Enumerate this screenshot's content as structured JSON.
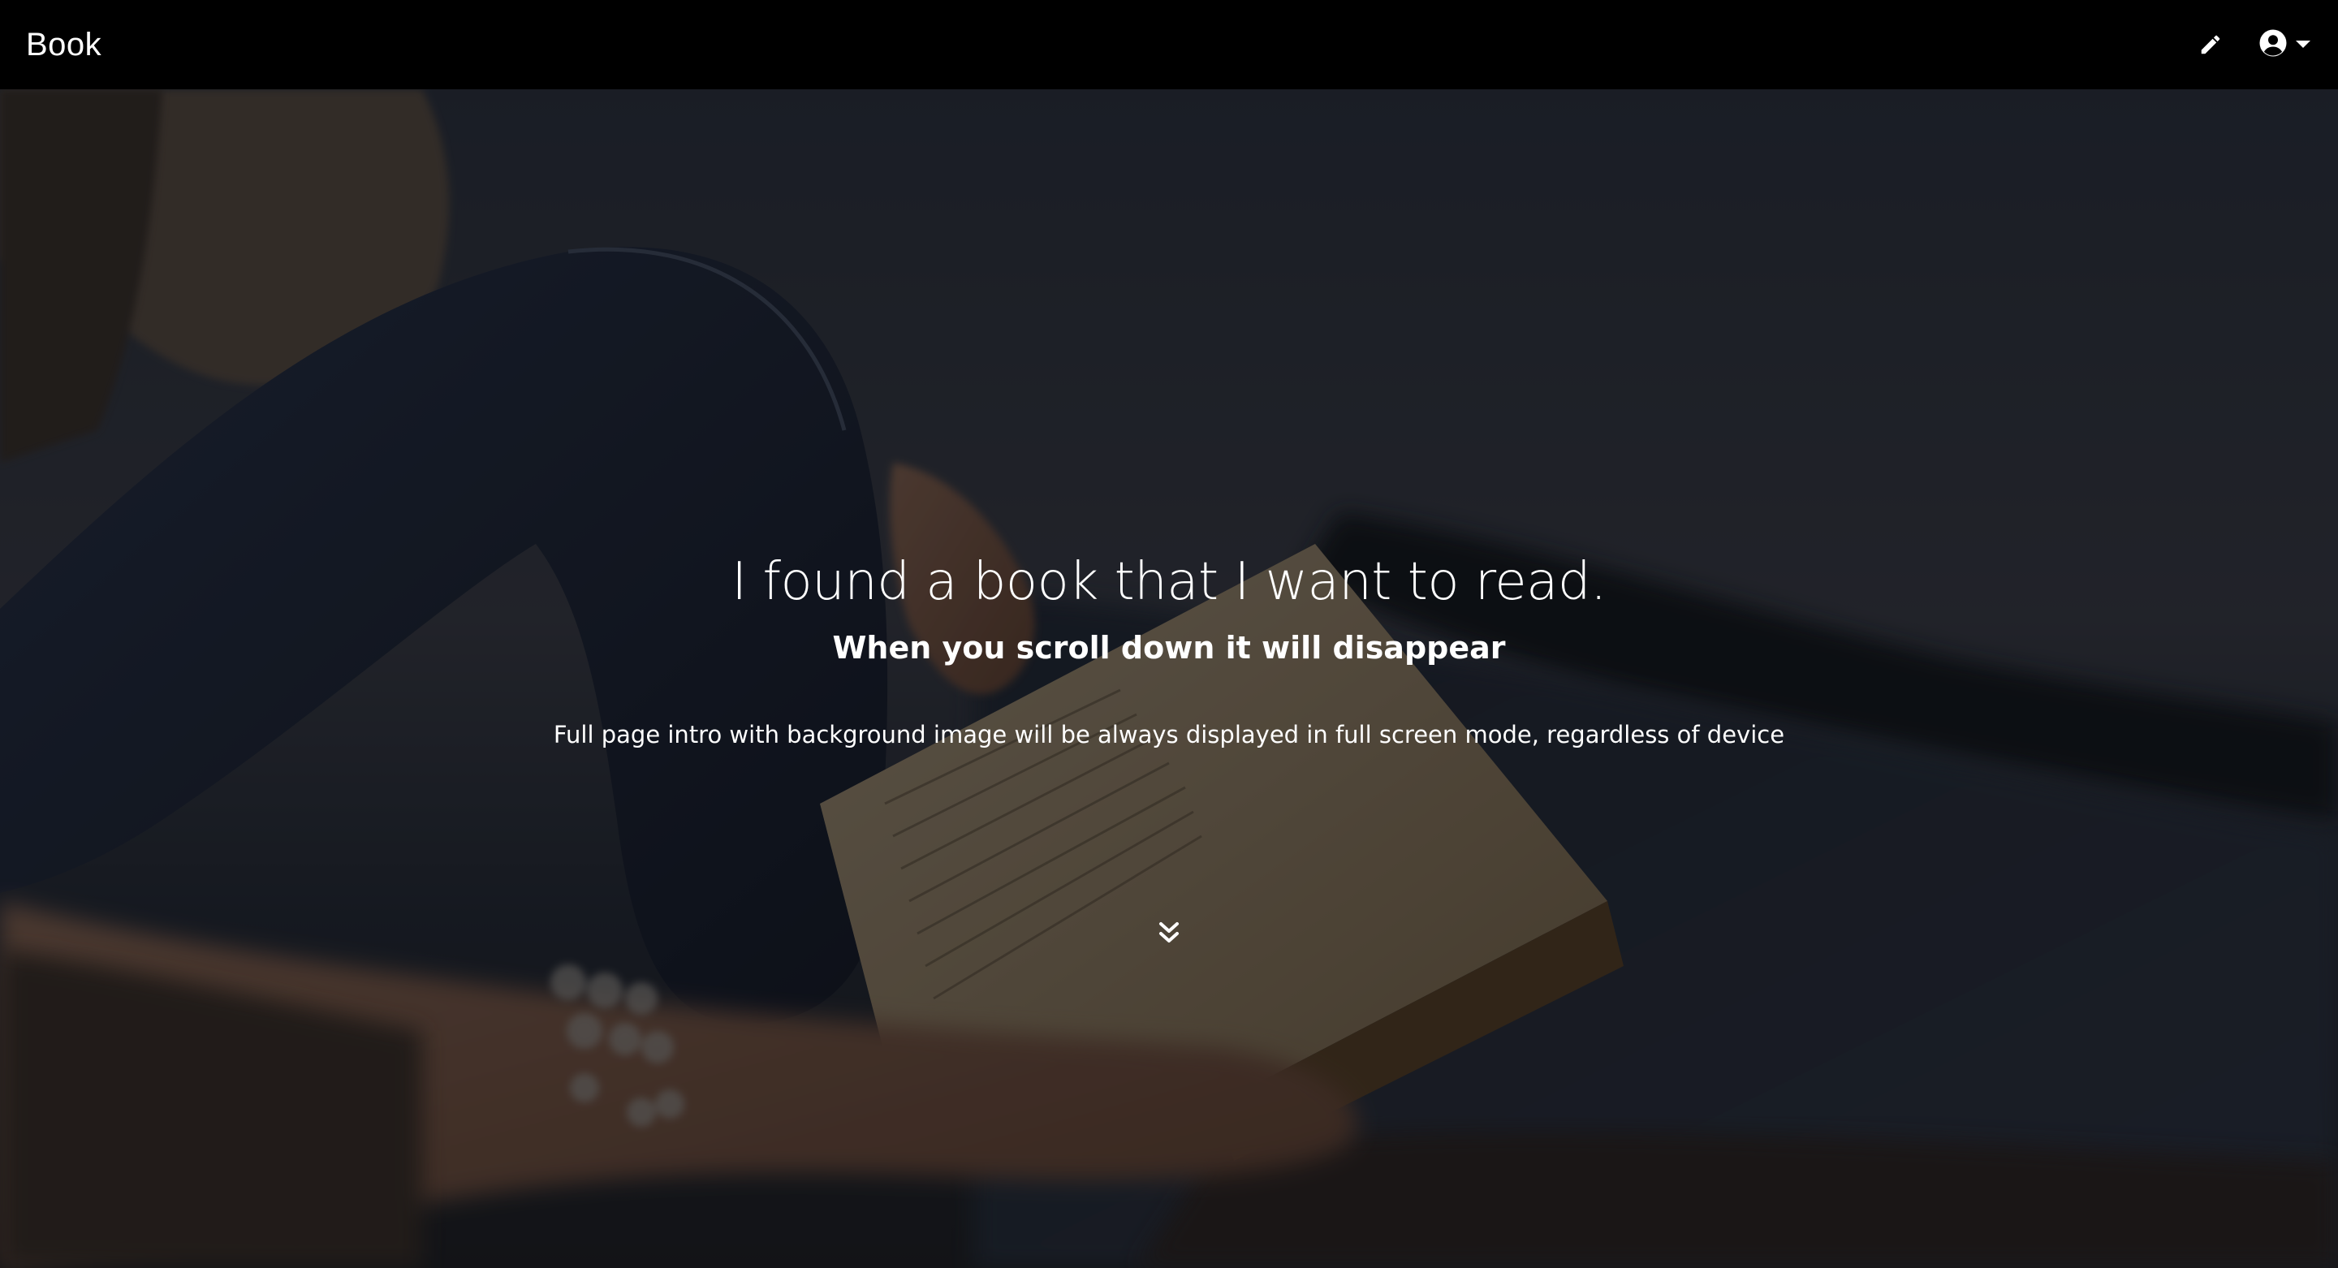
{
  "navbar": {
    "brand": "Book",
    "edit_icon": "pencil-icon",
    "account_icon": "user-circle-icon",
    "dropdown_icon": "caret-down-icon"
  },
  "hero": {
    "title": "I found a book that I want to read.",
    "subtitle": "When you scroll down it will disappear",
    "description": "Full page intro with background image will be always displayed in full screen mode, regardless of device",
    "scroll_icon": "double-chevron-down-icon"
  },
  "colors": {
    "navbar_bg": "#000000",
    "text": "#ffffff",
    "overlay": "rgba(0,0,0,0.55)"
  }
}
